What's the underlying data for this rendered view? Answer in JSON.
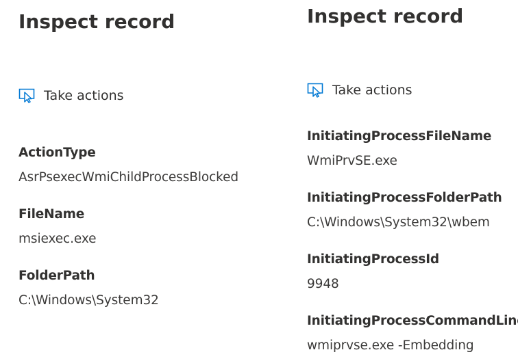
{
  "left_panel": {
    "title": "Inspect record",
    "action_label": "Take actions",
    "action_icon": "cursor-select-icon",
    "fields": [
      {
        "key": "ActionType",
        "value": "AsrPsexecWmiChildProcessBlocked"
      },
      {
        "key": "FileName",
        "value": "msiexec.exe"
      },
      {
        "key": "FolderPath",
        "value": "C:\\Windows\\System32"
      }
    ]
  },
  "right_panel": {
    "title": "Inspect record",
    "action_label": "Take actions",
    "action_icon": "cursor-select-icon",
    "fields": [
      {
        "key": "InitiatingProcessFileName",
        "value": "WmiPrvSE.exe"
      },
      {
        "key": "InitiatingProcessFolderPath",
        "value": "C:\\Windows\\System32\\wbem"
      },
      {
        "key": "InitiatingProcessId",
        "value": "9948"
      },
      {
        "key": "InitiatingProcessCommandLine",
        "value": "wmiprvse.exe -Embedding"
      }
    ]
  },
  "colors": {
    "accent": "#0078d4",
    "text": "#323130"
  }
}
